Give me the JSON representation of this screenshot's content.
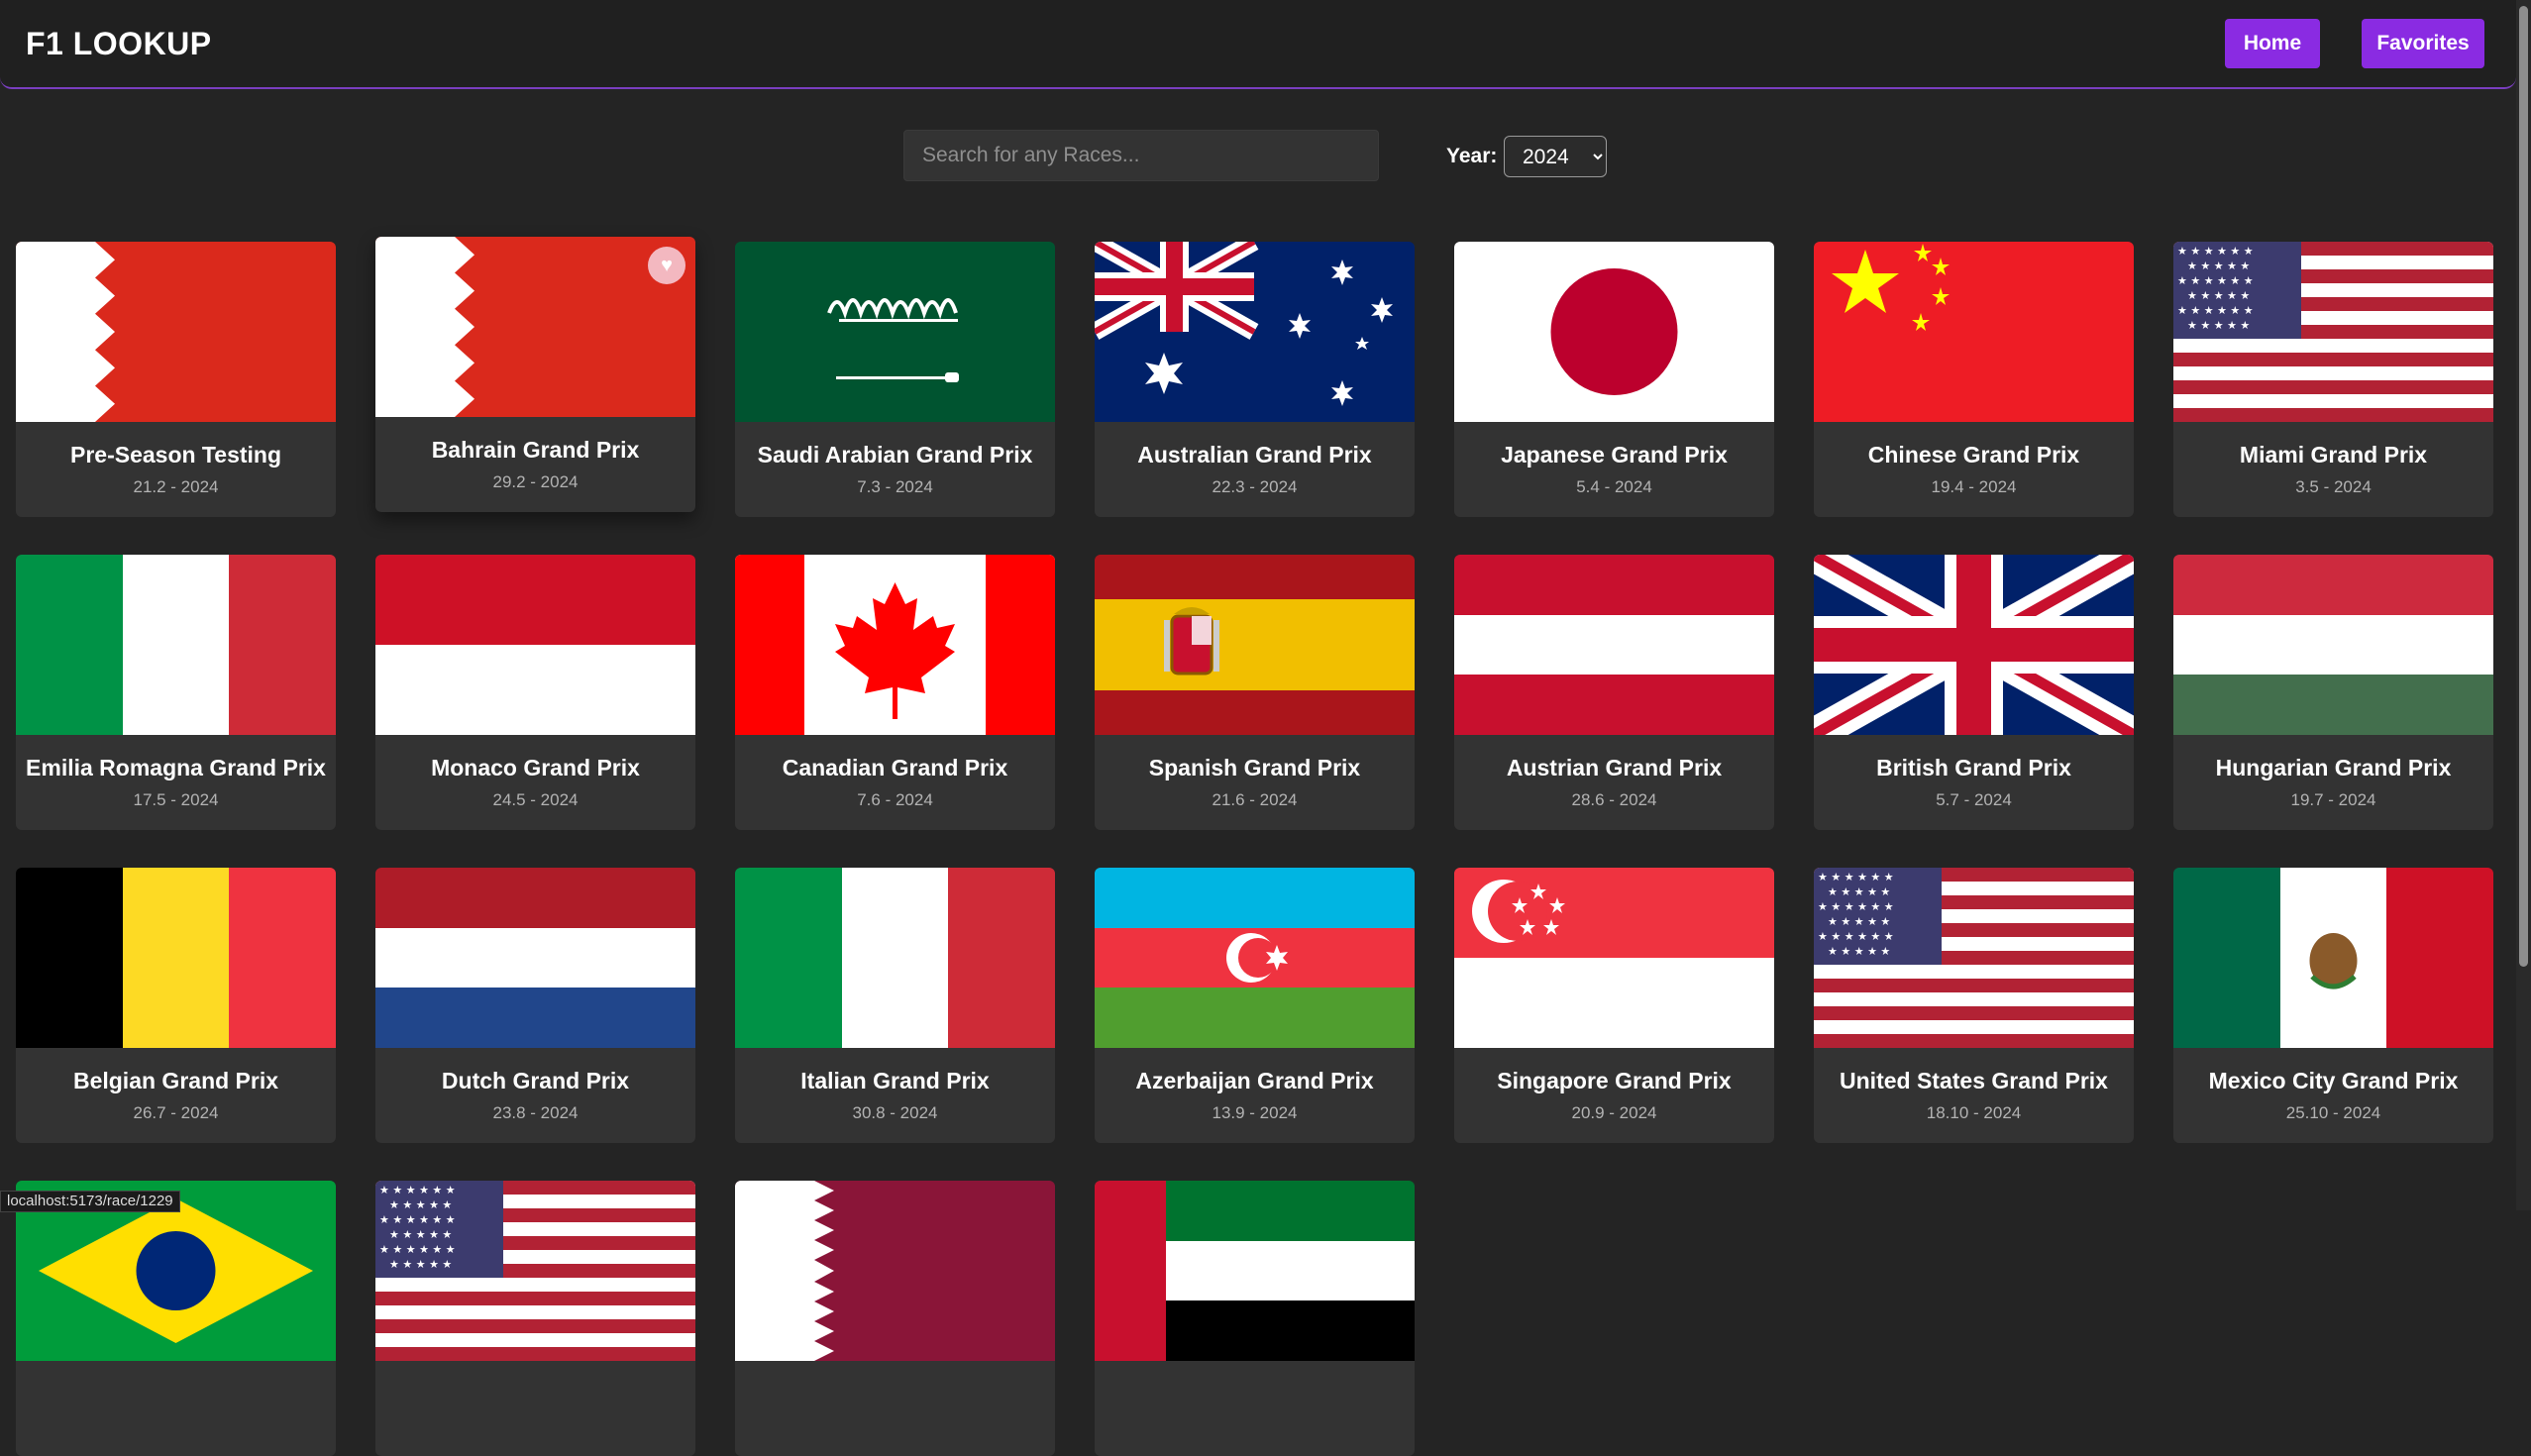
{
  "app": {
    "title": "F1 LOOKUP"
  },
  "nav": {
    "home": "Home",
    "favorites": "Favorites"
  },
  "search": {
    "placeholder": "Search for any Races...",
    "value": ""
  },
  "filter": {
    "year_label": "Year:",
    "year_selected": "2024"
  },
  "status_url": "localhost:5173/race/1229",
  "races": [
    {
      "name": "Pre-Season Testing",
      "date": "21.2 - 2024",
      "flag": "bahrain-flag"
    },
    {
      "name": "Bahrain Grand Prix",
      "date": "29.2 - 2024",
      "flag": "bahrain-flag",
      "favorite": true
    },
    {
      "name": "Saudi Arabian Grand Prix",
      "date": "7.3 - 2024",
      "flag": "saudi-flag"
    },
    {
      "name": "Australian Grand Prix",
      "date": "22.3 - 2024",
      "flag": "australia-flag"
    },
    {
      "name": "Japanese Grand Prix",
      "date": "5.4 - 2024",
      "flag": "japan-flag"
    },
    {
      "name": "Chinese Grand Prix",
      "date": "19.4 - 2024",
      "flag": "china-flag"
    },
    {
      "name": "Miami Grand Prix",
      "date": "3.5 - 2024",
      "flag": "usa-flag"
    },
    {
      "name": "Emilia Romagna Grand Prix",
      "date": "17.5 - 2024",
      "flag": "italy-flag"
    },
    {
      "name": "Monaco Grand Prix",
      "date": "24.5 - 2024",
      "flag": "monaco-flag"
    },
    {
      "name": "Canadian Grand Prix",
      "date": "7.6 - 2024",
      "flag": "canada-flag"
    },
    {
      "name": "Spanish Grand Prix",
      "date": "21.6 - 2024",
      "flag": "spain-flag"
    },
    {
      "name": "Austrian Grand Prix",
      "date": "28.6 - 2024",
      "flag": "austria-flag"
    },
    {
      "name": "British Grand Prix",
      "date": "5.7 - 2024",
      "flag": "uk-flag"
    },
    {
      "name": "Hungarian Grand Prix",
      "date": "19.7 - 2024",
      "flag": "hungary-flag"
    },
    {
      "name": "Belgian Grand Prix",
      "date": "26.7 - 2024",
      "flag": "belgium-flag"
    },
    {
      "name": "Dutch Grand Prix",
      "date": "23.8 - 2024",
      "flag": "netherlands-flag"
    },
    {
      "name": "Italian Grand Prix",
      "date": "30.8 - 2024",
      "flag": "italy-flag"
    },
    {
      "name": "Azerbaijan Grand Prix",
      "date": "13.9 - 2024",
      "flag": "azerbaijan-flag"
    },
    {
      "name": "Singapore Grand Prix",
      "date": "20.9 - 2024",
      "flag": "singapore-flag"
    },
    {
      "name": "United States Grand Prix",
      "date": "18.10 - 2024",
      "flag": "usa-flag"
    },
    {
      "name": "Mexico City Grand Prix",
      "date": "25.10 - 2024",
      "flag": "mexico-flag"
    },
    {
      "name": "",
      "date": "",
      "flag": "brazil-flag"
    },
    {
      "name": "",
      "date": "",
      "flag": "usa-flag"
    },
    {
      "name": "",
      "date": "",
      "flag": "qatar-flag"
    },
    {
      "name": "",
      "date": "",
      "flag": "uae-flag"
    }
  ]
}
